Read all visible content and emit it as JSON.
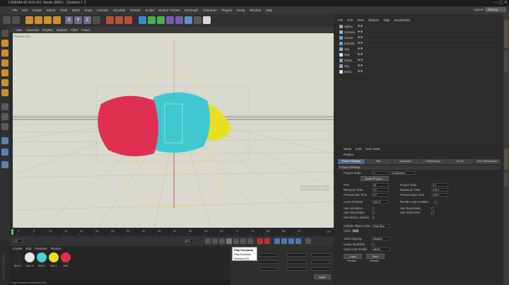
{
  "window": {
    "title": "CINEMA 4D R16.021 Studio (RBV) - [Untitled 1 *]"
  },
  "menu": [
    "File",
    "Edit",
    "Create",
    "Select",
    "Tools",
    "Mesh",
    "Snap",
    "Animate",
    "Simulate",
    "Render",
    "Sculpt",
    "Motion Tracker",
    "MoGraph",
    "Character",
    "Plugins",
    "Script",
    "Window",
    "Help"
  ],
  "layout": {
    "label": "Layout:",
    "value": "Startup"
  },
  "viewport": {
    "menu": [
      "View",
      "Cameras",
      "Display",
      "Options",
      "Filter",
      "Panel"
    ],
    "label": "Perspective"
  },
  "timeline": {
    "ticks": [
      "0",
      "5",
      "10",
      "15",
      "20",
      "25",
      "30",
      "35",
      "40",
      "45",
      "50",
      "55",
      "60",
      "65",
      "70",
      "75",
      "80",
      "85",
      "90"
    ],
    "frame_readout": "0 F",
    "start": "0 F",
    "end": "90 F"
  },
  "tooltip": {
    "lines": [
      "Play Forwards",
      "Play forwards",
      "Shortcut F8"
    ]
  },
  "materials": {
    "menu": [
      "Create",
      "Edit",
      "Function",
      "Texture"
    ],
    "items": [
      {
        "name": "Mat.4",
        "color": "#2a2a2a"
      },
      {
        "name": "Mat.3",
        "color": "#e8e8e8"
      },
      {
        "name": "Mat.2",
        "color": "#4ad0d8"
      },
      {
        "name": "Mat.1",
        "color": "#e8e020"
      },
      {
        "name": "Mat",
        "color": "#e03050"
      }
    ]
  },
  "status": "Play Forwards [Shortcut F8]",
  "coords": {
    "apply": "Apply"
  },
  "objects": {
    "menu": [
      "File",
      "Edit",
      "View",
      "Objects",
      "Tags",
      "Bookmarks"
    ],
    "rows": [
      {
        "name": "Spline",
        "color": "#8ac"
      },
      {
        "name": "Camera",
        "color": "#aaa"
      },
      {
        "name": "Cloner",
        "color": "#6ad"
      },
      {
        "name": "Extrude",
        "color": "#6ad"
      },
      {
        "name": "Sky",
        "color": "#8ac"
      },
      {
        "name": "Null",
        "color": "#ddd"
      },
      {
        "name": "Plane",
        "color": "#6ad"
      },
      {
        "name": "Sky",
        "color": "#8ac"
      },
      {
        "name": "Null.1",
        "color": "#ddd"
      }
    ]
  },
  "attributes": {
    "menu": [
      "Mode",
      "Edit",
      "User Data"
    ],
    "object_label": "Project",
    "tabs": [
      "Project Settings",
      "Info",
      "Dynamics",
      "Referencing",
      "To Do",
      "Key Interpolation"
    ],
    "section": "Project Settings",
    "project_scale_label": "Project Scale",
    "project_scale_value": "1",
    "project_scale_unit": "Centimeters",
    "scale_button": "Scale Project...",
    "fps_label": "FPS",
    "fps": "30",
    "project_time_label": "Project Time",
    "project_time": "0 F",
    "min_time_label": "Minimum Time",
    "min_time": "0 F",
    "max_time_label": "Maximum Time",
    "max_time": "270 F",
    "prev_min_label": "Preview Min Time",
    "prev_min": "0 F",
    "prev_max_label": "Preview Max Time",
    "prev_max": "270 F",
    "lod_label": "Level of Detail",
    "lod": "100 %",
    "render_lod_label": "Render LOD in Editor",
    "use_animation": "Use Animation",
    "use_expression": "Use Expression",
    "use_generators": "Use Generators",
    "use_deformers": "Use Deformers",
    "use_motion": "Use Motion System",
    "default_color_label": "Default Object Color",
    "default_color": "Gray Blue",
    "color_label": "Color",
    "view_clipping_label": "View Clipping",
    "view_clipping": "Medium",
    "linear_workflow_label": "Linear Workflow",
    "input_color_label": "Input Color Profile",
    "input_color": "sRGB",
    "load_preset": "Load Preset...",
    "save_preset": "Save Preset..."
  },
  "brand": "MAXON CINEMA 4D"
}
